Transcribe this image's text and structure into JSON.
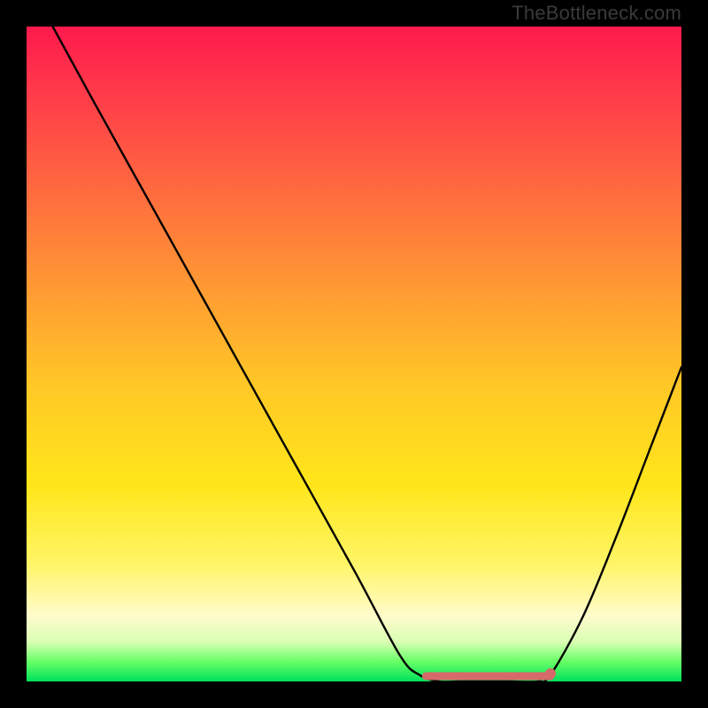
{
  "watermark": "TheBottleneck.com",
  "colors": {
    "frame": "#000000",
    "gradient_top": "#ff1a4d",
    "gradient_mid": "#ffe61a",
    "gradient_bottom": "#00e05a",
    "curve": "#000000",
    "marker_stroke": "#d66a6a",
    "marker_fill": "#d66a6a"
  },
  "chart_data": {
    "type": "line",
    "title": "",
    "xlabel": "",
    "ylabel": "",
    "xlim": [
      0,
      100
    ],
    "ylim": [
      0,
      100
    ],
    "x": [
      4,
      10,
      20,
      30,
      40,
      50,
      57,
      60,
      63,
      66,
      70,
      74,
      78,
      80,
      85,
      90,
      95,
      100
    ],
    "y": [
      100,
      89,
      71,
      53,
      35,
      17,
      4,
      1,
      0,
      0,
      0,
      0,
      0,
      1,
      10,
      22,
      35,
      48
    ],
    "optimal_range_x": [
      61,
      80
    ],
    "optimal_marker": {
      "x": 80,
      "y": 1.2
    },
    "note": "x and y are in percent of the plot area; y=0 is the bottom (optimal/green), y=100 is the top (worst/red). Values are read from the rendered curve."
  }
}
